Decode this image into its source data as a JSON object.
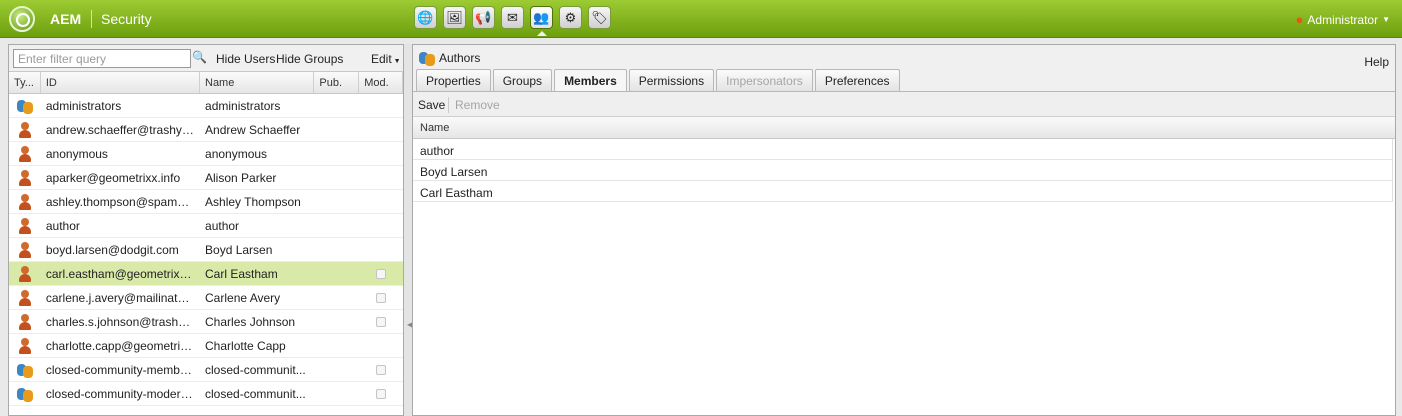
{
  "topbar": {
    "brand": "AEM",
    "section": "Security",
    "user": "Administrator",
    "app_icons": [
      "globe-icon",
      "images-icon",
      "campaign-icon",
      "mail-icon",
      "users-icon",
      "tools-icon",
      "tag-icon"
    ]
  },
  "left": {
    "filter_placeholder": "Enter filter query",
    "hide_users": "Hide Users",
    "hide_groups": "Hide Groups",
    "edit": "Edit",
    "columns": [
      "Ty...",
      "ID",
      "Name",
      "Pub.",
      "Mod."
    ],
    "rows": [
      {
        "type": "group",
        "id": "administrators",
        "name": "administrators"
      },
      {
        "type": "user",
        "id": "andrew.schaeffer@trashyma...",
        "name": "Andrew Schaeffer"
      },
      {
        "type": "user",
        "id": "anonymous",
        "name": "anonymous"
      },
      {
        "type": "user",
        "id": "aparker@geometrixx.info",
        "name": "Alison Parker"
      },
      {
        "type": "user",
        "id": "ashley.thompson@spambob....",
        "name": "Ashley Thompson"
      },
      {
        "type": "user",
        "id": "author",
        "name": "author"
      },
      {
        "type": "user",
        "id": "boyd.larsen@dodgit.com",
        "name": "Boyd Larsen"
      },
      {
        "type": "user",
        "id": "carl.eastham@geometrixx-m...",
        "name": "Carl Eastham"
      },
      {
        "type": "user",
        "id": "carlene.j.avery@mailinator.c...",
        "name": "Carlene Avery"
      },
      {
        "type": "user",
        "id": "charles.s.johnson@trashyma...",
        "name": "Charles Johnson"
      },
      {
        "type": "user",
        "id": "charlotte.capp@geometrixx-...",
        "name": "Charlotte Capp"
      },
      {
        "type": "group",
        "id": "closed-community-members",
        "name": "closed-communit..."
      },
      {
        "type": "group",
        "id": "closed-community-moderators",
        "name": "closed-communit..."
      }
    ]
  },
  "right": {
    "title": "Authors",
    "help": "Help",
    "tabs": [
      "Properties",
      "Groups",
      "Members",
      "Permissions",
      "Impersonators",
      "Preferences"
    ],
    "save": "Save",
    "remove": "Remove",
    "members_header": "Name",
    "members": [
      "author",
      "Boyd Larsen",
      "Carl Eastham"
    ]
  }
}
